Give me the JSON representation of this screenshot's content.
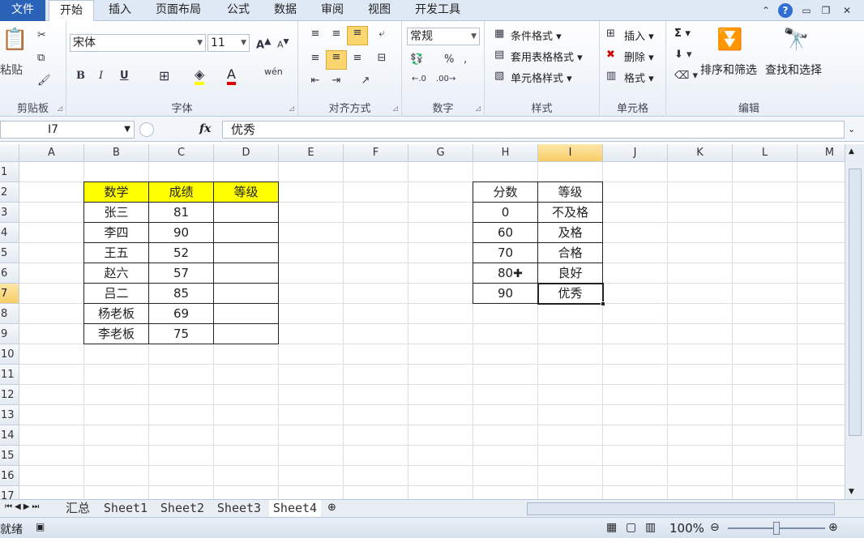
{
  "tabs": [
    "文件",
    "开始",
    "插入",
    "页面布局",
    "公式",
    "数据",
    "审阅",
    "视图",
    "开发工具"
  ],
  "active_tab": "开始",
  "window_icons": [
    "ribbon-collapse-icon",
    "help-icon",
    "minimize-icon",
    "restore-icon",
    "close-icon"
  ],
  "ribbon": {
    "clipboard": {
      "label": "剪贴板",
      "paste": "粘贴"
    },
    "font": {
      "label": "字体",
      "family": "宋体",
      "size": "11",
      "bold": "B",
      "italic": "I",
      "underline": "U"
    },
    "alignment": {
      "label": "对齐方式"
    },
    "number": {
      "label": "数字",
      "format": "常规",
      "percent": "%"
    },
    "styles": {
      "label": "样式",
      "cond_format": "条件格式",
      "table_format": "套用表格格式",
      "cell_style": "单元格样式"
    },
    "cells": {
      "label": "单元格",
      "insert": "插入",
      "delete": "删除",
      "format": "格式"
    },
    "editing": {
      "label": "编辑",
      "sigma": "Σ",
      "sort": "排序和筛选",
      "find": "查找和选择"
    }
  },
  "formula_bar": {
    "name_box": "I7",
    "fx": "fx",
    "value": "优秀"
  },
  "columns": [
    "A",
    "B",
    "C",
    "D",
    "E",
    "F",
    "G",
    "H",
    "I",
    "J",
    "K",
    "L",
    "M"
  ],
  "selected_column": "I",
  "rows": [
    "1",
    "2",
    "3",
    "4",
    "5",
    "6",
    "7",
    "8",
    "9",
    "10",
    "11",
    "12",
    "13",
    "14",
    "15",
    "16",
    "17"
  ],
  "selected_row": "7",
  "table1": {
    "headers": [
      "数学",
      "成绩",
      "等级"
    ],
    "rows": [
      [
        "张三",
        "81",
        ""
      ],
      [
        "李四",
        "90",
        ""
      ],
      [
        "王五",
        "52",
        ""
      ],
      [
        "赵六",
        "57",
        ""
      ],
      [
        "吕二",
        "85",
        ""
      ],
      [
        "杨老板",
        "69",
        ""
      ],
      [
        "李老板",
        "75",
        ""
      ]
    ]
  },
  "table2": {
    "headers": [
      "分数",
      "等级"
    ],
    "rows": [
      [
        "0",
        "不及格"
      ],
      [
        "60",
        "及格"
      ],
      [
        "70",
        "合格"
      ],
      [
        "80",
        "良好"
      ],
      [
        "90",
        "优秀"
      ]
    ]
  },
  "sheet_tabs": [
    "汇总",
    "Sheet1",
    "Sheet2",
    "Sheet3",
    "Sheet4"
  ],
  "active_sheet": "Sheet4",
  "status": {
    "ready": "就绪",
    "zoom": "100%"
  }
}
